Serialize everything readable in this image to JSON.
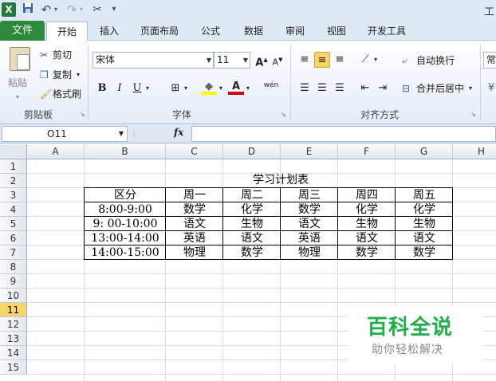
{
  "window": {
    "title": "工"
  },
  "qat": {
    "undo": "↶",
    "redo": "↷",
    "customize": "▾"
  },
  "tabs": {
    "file": "文件",
    "items": [
      "开始",
      "插入",
      "页面布局",
      "公式",
      "数据",
      "审阅",
      "视图",
      "开发工具"
    ],
    "active": "开始"
  },
  "ribbon": {
    "clipboard": {
      "paste": "粘贴",
      "cut": "剪切",
      "copy": "复制",
      "format_painter": "格式刷",
      "group_label": "剪贴板"
    },
    "font": {
      "font_name": "宋体",
      "font_size": "11",
      "bold": "B",
      "italic": "I",
      "underline": "U",
      "group_label": "字体",
      "phonetic": "wén"
    },
    "alignment": {
      "wrap_text": "自动换行",
      "merge_center": "合并后居中",
      "group_label": "对齐方式"
    },
    "number": {
      "partial": "常"
    }
  },
  "formula_bar": {
    "name_box": "O11",
    "fx": "fx",
    "value": ""
  },
  "grid": {
    "columns": [
      "A",
      "B",
      "C",
      "D",
      "E",
      "F",
      "G",
      "H"
    ],
    "rows": [
      "1",
      "2",
      "3",
      "4",
      "5",
      "6",
      "7",
      "8",
      "9",
      "10",
      "11",
      "12",
      "13",
      "14",
      "15"
    ],
    "active_row": "11"
  },
  "sheet": {
    "title": "学习计划表",
    "header": [
      "区分",
      "周一",
      "周二",
      "周三",
      "周四",
      "周五"
    ],
    "rows": [
      [
        "8:00-9:00",
        "数学",
        "化学",
        "数学",
        "化学",
        "化学"
      ],
      [
        "9: 00-10:00",
        "语文",
        "生物",
        "语文",
        "生物",
        "生物"
      ],
      [
        "13:00-14:00",
        "英语",
        "语文",
        "英语",
        "语文",
        "语文"
      ],
      [
        "14:00-15:00",
        "物理",
        "数学",
        "物理",
        "数学",
        "数学"
      ]
    ]
  },
  "watermark": {
    "brand": "百科全说",
    "slogan": "助你轻松解决"
  },
  "colors": {
    "file_tab": "#2d8a3c",
    "active_row_header": "#f9d56b",
    "watermark_brand": "#1fae4a"
  }
}
